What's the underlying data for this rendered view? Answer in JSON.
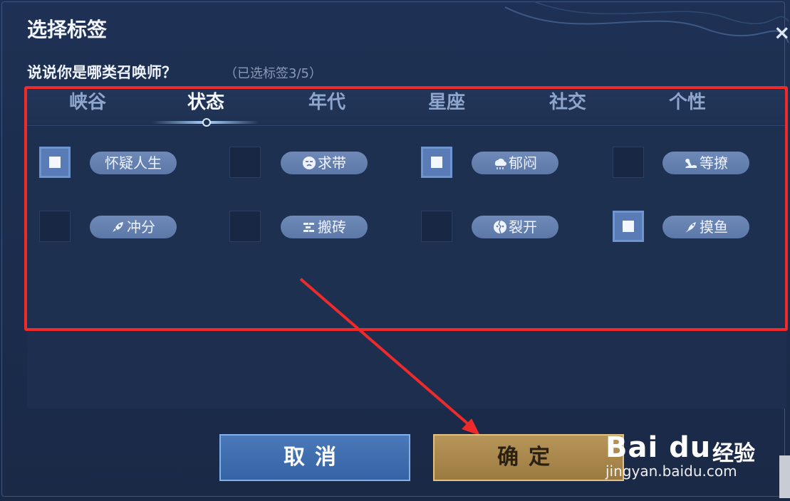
{
  "dialog": {
    "title": "选择标签",
    "question": "说说你是哪类召唤师？",
    "selected_count": "（已选标签3/5）",
    "close_glyph": "×"
  },
  "tabs": [
    {
      "label": "峡谷",
      "active": false
    },
    {
      "label": "状态",
      "active": true
    },
    {
      "label": "年代",
      "active": false
    },
    {
      "label": "星座",
      "active": false
    },
    {
      "label": "社交",
      "active": false
    },
    {
      "label": "个性",
      "active": false
    }
  ],
  "tags": [
    {
      "label": "怀疑人生",
      "checked": true,
      "icon": "none"
    },
    {
      "label": "求带",
      "checked": false,
      "icon": "crying-face-icon"
    },
    {
      "label": "郁闷",
      "checked": true,
      "icon": "rain-cloud-icon"
    },
    {
      "label": "等撩",
      "checked": false,
      "icon": "lounging-figure-icon"
    },
    {
      "label": "冲分",
      "checked": false,
      "icon": "rocket-icon"
    },
    {
      "label": "搬砖",
      "checked": false,
      "icon": "bricks-icon"
    },
    {
      "label": "裂开",
      "checked": false,
      "icon": "cracked-face-icon"
    },
    {
      "label": "摸鱼",
      "checked": true,
      "icon": "fish-icon"
    }
  ],
  "buttons": {
    "cancel": "取消",
    "confirm": "确定"
  },
  "watermark": {
    "logo": "Bai du",
    "word": "经验",
    "url": "jingyan.baidu.com"
  },
  "colors": {
    "annotation_red": "#ef2a2a",
    "confirm_gold": "#b8965a",
    "cancel_blue": "#4a78b8"
  }
}
